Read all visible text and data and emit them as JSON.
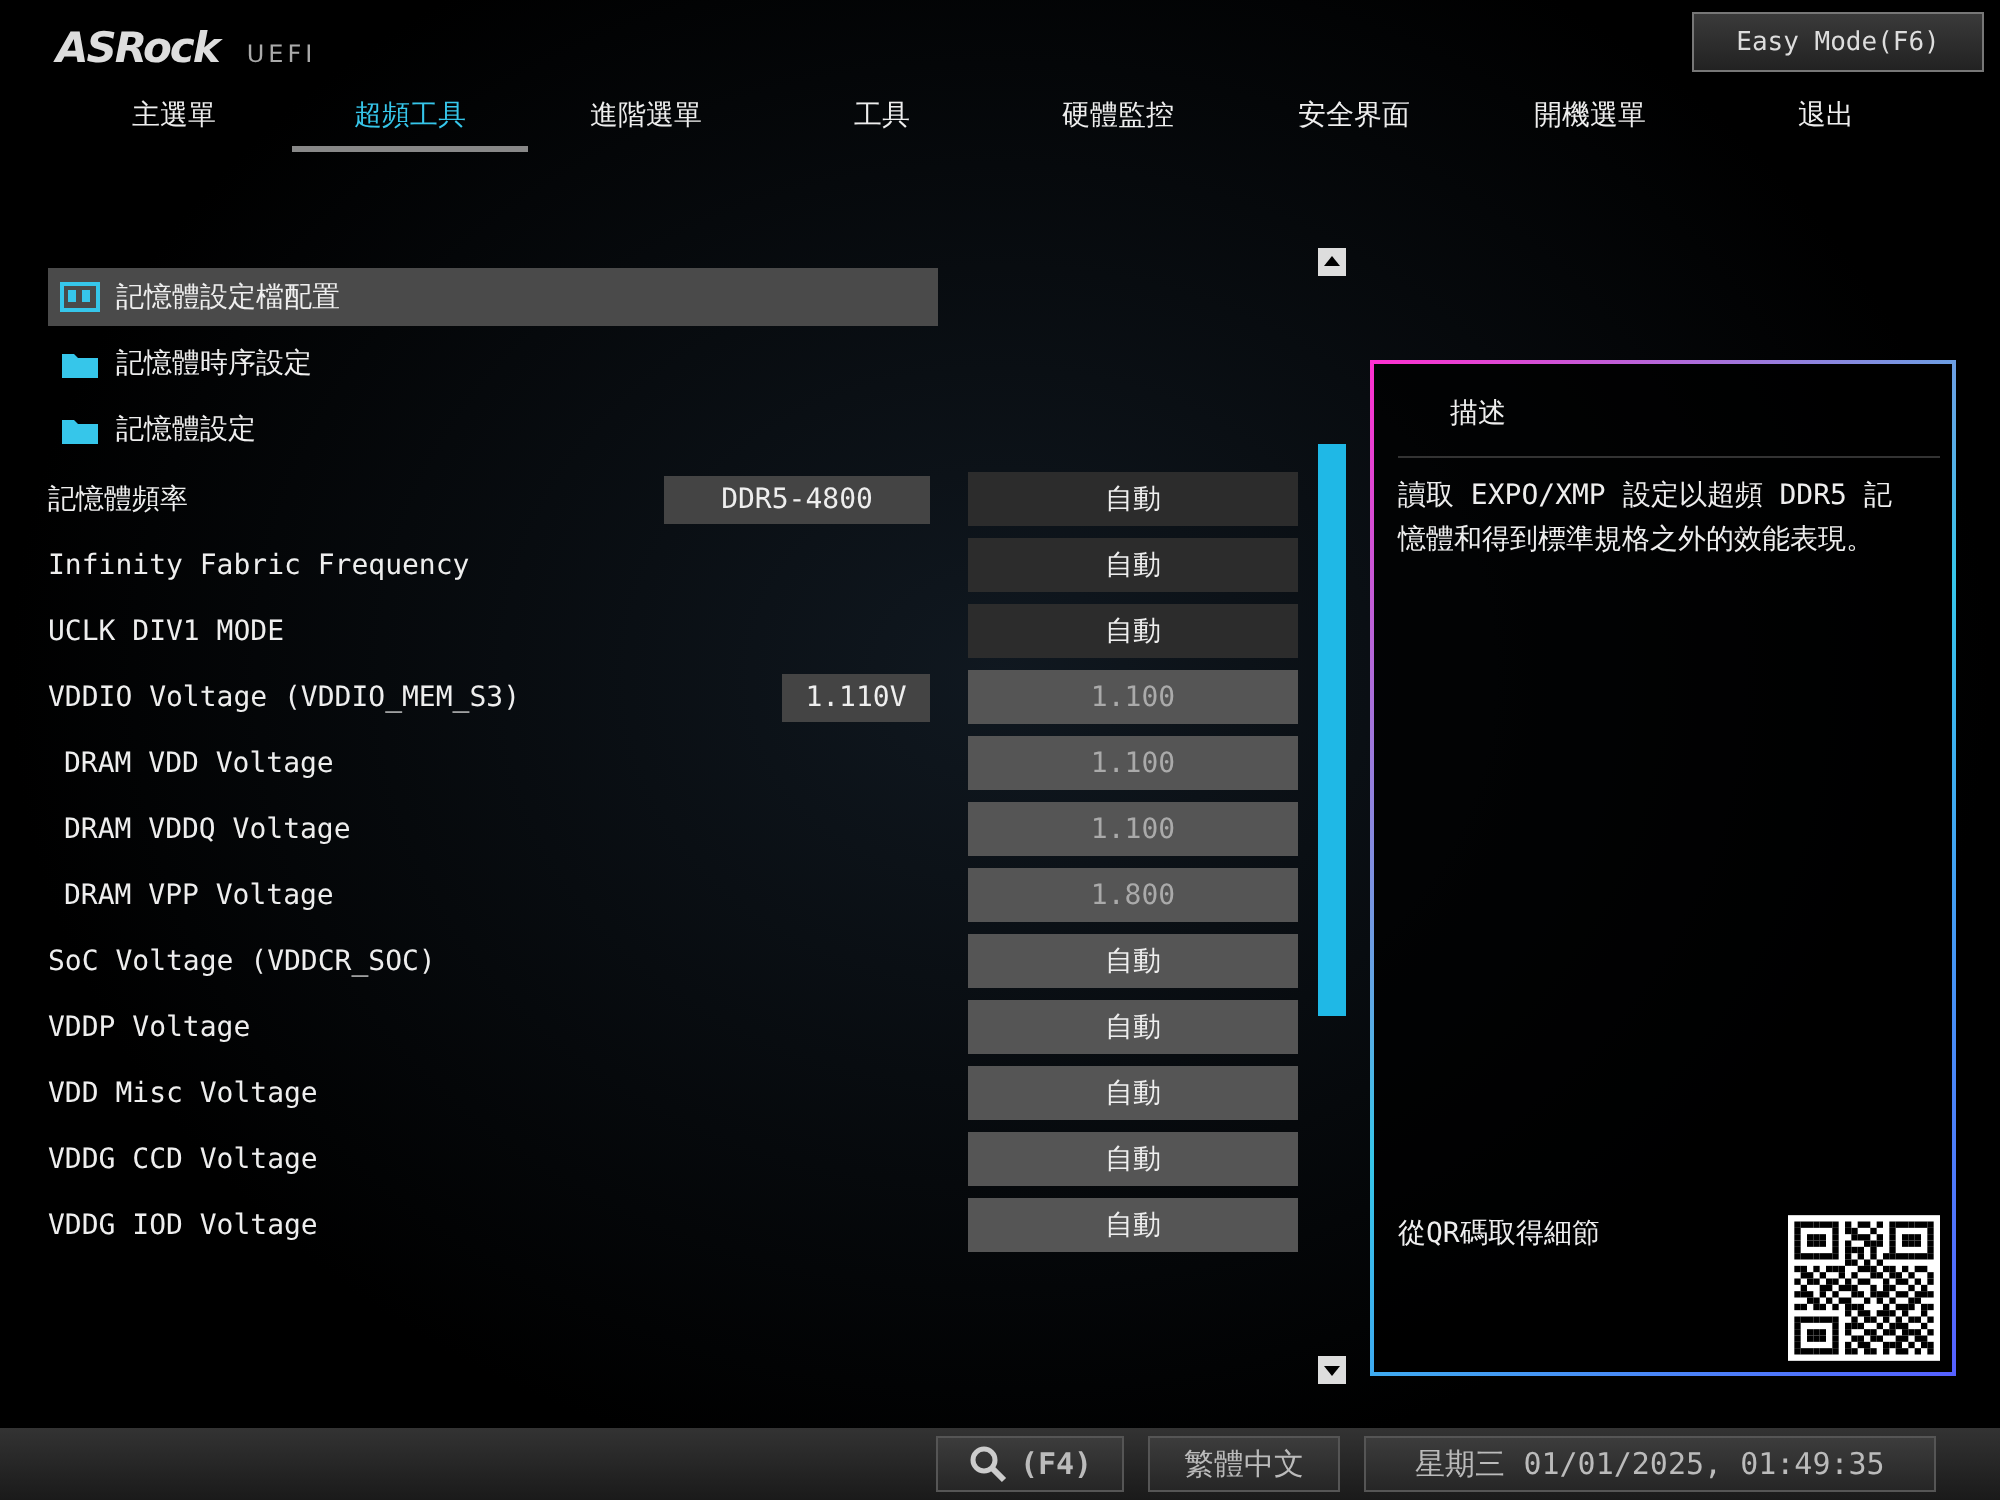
{
  "header": {
    "logo": "ASRock",
    "product": "UEFI",
    "mode_button": "Easy Mode(F6)"
  },
  "tabs": [
    {
      "label": "主選單",
      "selected": false
    },
    {
      "label": "超頻工具",
      "selected": true
    },
    {
      "label": "進階選單",
      "selected": false
    },
    {
      "label": "工具",
      "selected": false
    },
    {
      "label": "硬體監控",
      "selected": false
    },
    {
      "label": "安全界面",
      "selected": false
    },
    {
      "label": "開機選單",
      "selected": false
    },
    {
      "label": "退出",
      "selected": false
    }
  ],
  "menu_items": [
    {
      "label": "記憶體設定檔配置",
      "kind": "profile",
      "selected": true
    },
    {
      "label": "記憶體時序設定",
      "kind": "folder",
      "selected": false
    },
    {
      "label": "記憶體設定",
      "kind": "folder",
      "selected": false
    }
  ],
  "settings": [
    {
      "label": "記憶體頻率",
      "reading": "DDR5-4800",
      "value": "自動",
      "kind": "dropdown",
      "disabled": false
    },
    {
      "label": "Infinity Fabric Frequency",
      "value": "自動",
      "kind": "dropdown",
      "disabled": false
    },
    {
      "label": "UCLK DIV1 MODE",
      "value": "自動",
      "kind": "dropdown",
      "disabled": false
    },
    {
      "label": "VDDIO Voltage (VDDIO_MEM_S3)",
      "reading": "1.110V",
      "value": "1.100",
      "kind": "input",
      "disabled": true,
      "children": [
        {
          "label": "DRAM VDD Voltage",
          "value": "1.100",
          "kind": "input",
          "disabled": true
        },
        {
          "label": "DRAM VDDQ Voltage",
          "value": "1.100",
          "kind": "input",
          "disabled": true
        },
        {
          "label": "DRAM VPP Voltage",
          "value": "1.800",
          "kind": "input",
          "disabled": true
        }
      ]
    },
    {
      "label": "SoC Voltage (VDDCR_SOC)",
      "value": "自動",
      "kind": "input",
      "disabled": false
    },
    {
      "label": "VDDP Voltage",
      "value": "自動",
      "kind": "input",
      "disabled": false
    },
    {
      "label": "VDD Misc Voltage",
      "value": "自動",
      "kind": "input",
      "disabled": false
    },
    {
      "label": "VDDG CCD Voltage",
      "value": "自動",
      "kind": "input",
      "disabled": false
    },
    {
      "label": "VDDG IOD Voltage",
      "value": "自動",
      "kind": "input",
      "disabled": false
    }
  ],
  "description": {
    "title": "描述",
    "text": "讀取 EXPO/XMP 設定以超頻 DDR5 記憶體和得到標準規格之外的效能表現。",
    "qr_label": "從QR碼取得細節"
  },
  "status_bar": {
    "search_key": "(F4)",
    "language": "繁體中文",
    "datetime": "星期三 01/01/2025, 01:49:35"
  }
}
